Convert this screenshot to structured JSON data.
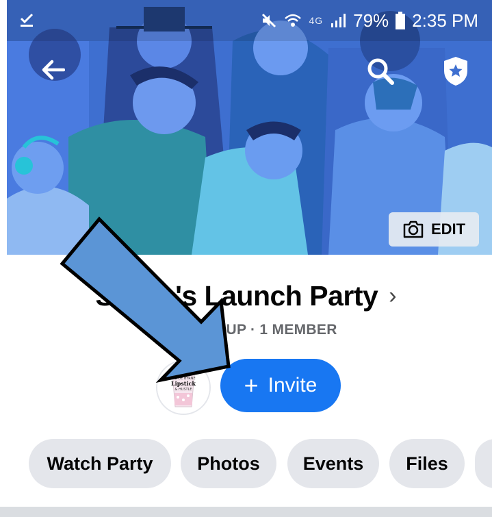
{
  "status_bar": {
    "battery": "79%",
    "time": "2:35 PM",
    "network": "4G"
  },
  "cover": {
    "edit_label": "EDIT"
  },
  "group": {
    "title": "Sh      's Launch Party",
    "meta": "P            OUP · 1 MEMBER",
    "avatar_text_top": "DIE DE BYRNE",
    "avatar_text_main": "Lipstick",
    "avatar_text_bottom": "& HUSTLE"
  },
  "invite": {
    "plus": "+",
    "label": "Invite"
  },
  "tabs": [
    "Watch Party",
    "Photos",
    "Events",
    "Files"
  ],
  "icons": {
    "back": "arrow-left-icon",
    "search": "search-icon",
    "shield": "shield-star-icon",
    "camera": "camera-icon",
    "chevron": "chevron-right-icon"
  },
  "colors": {
    "primary": "#1877f2",
    "cover": "#3d6fd2",
    "tab_bg": "#e4e6eb",
    "overlay_arrow": "#5b95d6"
  }
}
